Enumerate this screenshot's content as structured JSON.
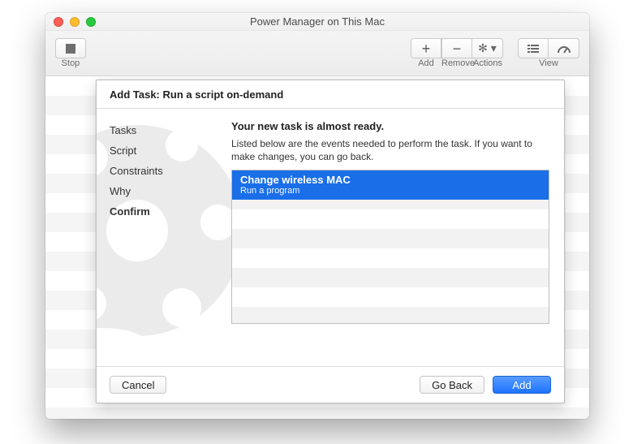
{
  "window": {
    "title": "Power Manager on This Mac"
  },
  "toolbar": {
    "stop": "Stop",
    "add": "Add",
    "remove": "Remove",
    "actions": "Actions",
    "view": "View"
  },
  "sheet": {
    "title": "Add Task: Run a script on-demand",
    "steps": [
      "Tasks",
      "Script",
      "Constraints",
      "Why",
      "Confirm"
    ],
    "active_step": 4,
    "heading": "Your new task is almost ready.",
    "description": "Listed below are the events needed to perform the task. If you want to make changes, you can go back.",
    "events": [
      {
        "name": "Change wireless MAC",
        "sub": "Run a program"
      }
    ],
    "cancel": "Cancel",
    "goback": "Go Back",
    "add": "Add"
  }
}
